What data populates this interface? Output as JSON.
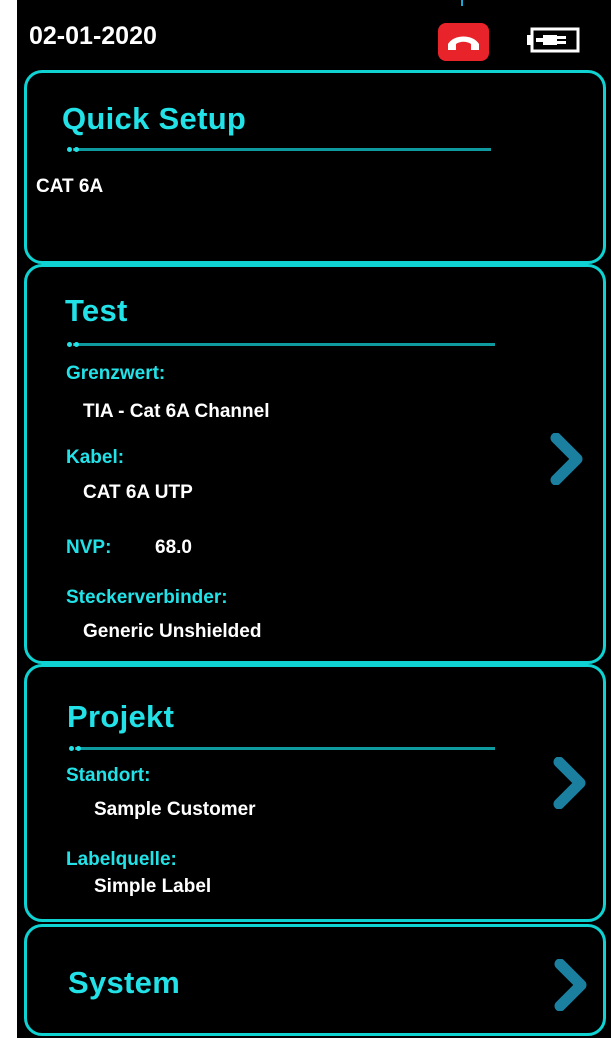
{
  "status": {
    "date": "02-01-2020"
  },
  "colors": {
    "accent": "#22e2e8",
    "border": "#0fd3d3",
    "call_red": "#e8232a",
    "background": "#000000"
  },
  "icons": {
    "phone": "phone-hangup-icon",
    "battery": "battery-charging-icon",
    "chevron": "chevron-right-icon"
  },
  "quick_setup": {
    "title": "Quick Setup",
    "value": "CAT 6A"
  },
  "test": {
    "title": "Test",
    "limit_label": "Grenzwert:",
    "limit_value": "TIA - Cat 6A Channel",
    "cable_label": "Kabel:",
    "cable_value": "CAT 6A UTP",
    "nvp_label": "NVP:",
    "nvp_value": "68.0",
    "connector_label": "Steckerverbinder:",
    "connector_value": "Generic Unshielded"
  },
  "project": {
    "title": "Projekt",
    "site_label": "Standort:",
    "site_value": "Sample Customer",
    "label_source_label": "Labelquelle:",
    "label_source_value": "Simple Label"
  },
  "system": {
    "title": "System"
  }
}
